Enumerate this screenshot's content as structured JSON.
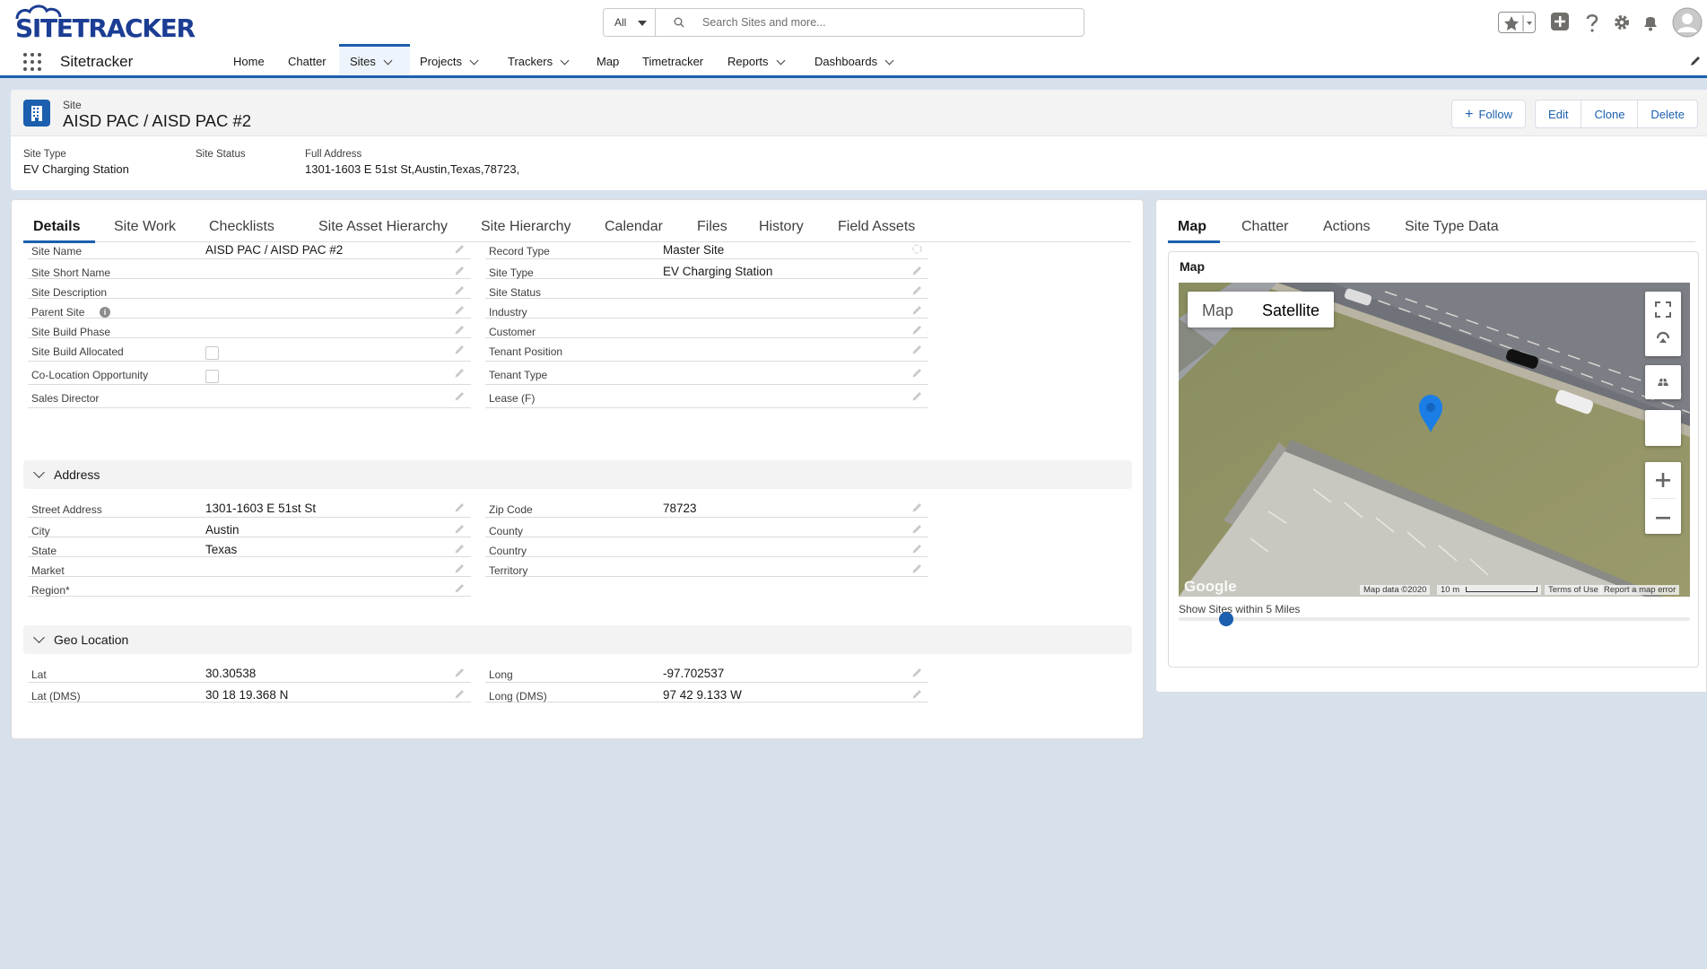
{
  "brand": {
    "logo_text": "SITETRACKER",
    "app_name": "Sitetracker"
  },
  "search": {
    "scope": "All",
    "placeholder": "Search Sites and more..."
  },
  "nav": {
    "items": [
      {
        "label": "Home"
      },
      {
        "label": "Chatter"
      },
      {
        "label": "Sites"
      },
      {
        "label": "Projects"
      },
      {
        "label": "Trackers"
      },
      {
        "label": "Map"
      },
      {
        "label": "Timetracker"
      },
      {
        "label": "Reports"
      },
      {
        "label": "Dashboards"
      }
    ],
    "active": "Sites"
  },
  "record": {
    "object_label": "Site",
    "title": "AISD PAC / AISD PAC #2",
    "buttons": {
      "follow": "Follow",
      "edit": "Edit",
      "clone": "Clone",
      "delete": "Delete"
    },
    "highlights": [
      {
        "label": "Site Type",
        "value": "EV Charging Station"
      },
      {
        "label": "Site Status",
        "value": ""
      },
      {
        "label": "Full Address",
        "value": "1301-1603 E 51st St,Austin,Texas,78723,"
      }
    ]
  },
  "details_tabs": [
    "Details",
    "Site Work",
    "Checklists",
    "Site Asset Hierarchy",
    "Site Hierarchy",
    "Calendar",
    "Files",
    "History",
    "Field Assets"
  ],
  "details": {
    "left": [
      {
        "label": "Site Name",
        "value": "AISD PAC / AISD PAC #2"
      },
      {
        "label": "Site Short Name",
        "value": ""
      },
      {
        "label": "Site Description",
        "value": ""
      },
      {
        "label": "Parent Site",
        "value": ""
      },
      {
        "label": "Site Build Phase",
        "value": ""
      },
      {
        "label": "Site Build Allocated",
        "value": ""
      },
      {
        "label": "Co-Location Opportunity",
        "value": ""
      },
      {
        "label": "Sales Director",
        "value": ""
      }
    ],
    "right": [
      {
        "label": "Record Type",
        "value": "Master Site"
      },
      {
        "label": "Site Type",
        "value": "EV Charging Station"
      },
      {
        "label": "Site Status",
        "value": ""
      },
      {
        "label": "Industry",
        "value": ""
      },
      {
        "label": "Customer",
        "value": ""
      },
      {
        "label": "Tenant Position",
        "value": ""
      },
      {
        "label": "Tenant Type",
        "value": ""
      },
      {
        "label": "Lease (F)",
        "value": ""
      }
    ]
  },
  "address": {
    "heading": "Address",
    "left": [
      {
        "label": "Street Address",
        "value": "1301-1603 E 51st St"
      },
      {
        "label": "City",
        "value": "Austin"
      },
      {
        "label": "State",
        "value": "Texas"
      },
      {
        "label": "Market",
        "value": ""
      },
      {
        "label": "Region*",
        "value": ""
      }
    ],
    "right": [
      {
        "label": "Zip Code",
        "value": "78723"
      },
      {
        "label": "County",
        "value": ""
      },
      {
        "label": "Country",
        "value": ""
      },
      {
        "label": "Territory",
        "value": ""
      }
    ]
  },
  "geo": {
    "heading": "Geo Location",
    "left": [
      {
        "label": "Lat",
        "value": "30.30538"
      },
      {
        "label": "Lat (DMS)",
        "value": "30 18 19.368 N"
      }
    ],
    "right": [
      {
        "label": "Long",
        "value": "-97.702537"
      },
      {
        "label": "Long (DMS)",
        "value": "97 42 9.133 W"
      }
    ]
  },
  "side_tabs": [
    "Map",
    "Chatter",
    "Actions",
    "Site Type Data"
  ],
  "map": {
    "title": "Map",
    "type_map": "Map",
    "type_satellite": "Satellite",
    "google": "Google",
    "map_data": "Map data ©2020",
    "scale": "10 m",
    "terms": "Terms of Use",
    "report": "Report a map error",
    "slider_label": "Show Sites within 5 Miles",
    "slider_value_miles": 5
  },
  "colors": {
    "brand_blue": "#1b5fae",
    "logo_blue": "#1b3d93",
    "background": "#d6e1ec"
  }
}
